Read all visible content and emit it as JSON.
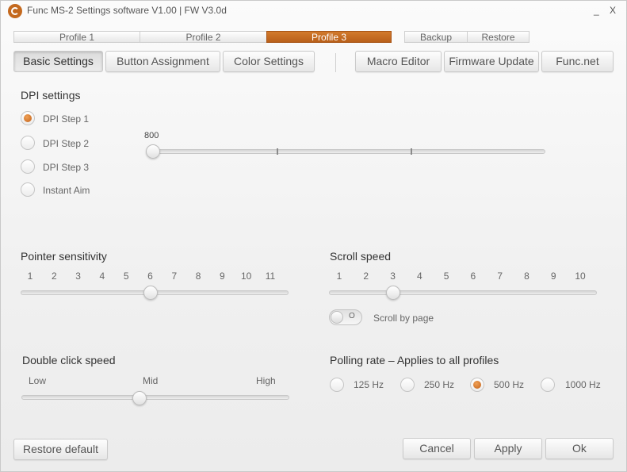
{
  "window": {
    "title": "Func MS-2 Settings software V1.00 | FW V3.0d",
    "minimize_label": "_",
    "close_label": "X"
  },
  "profiles": {
    "tabs": [
      "Profile 1",
      "Profile 2",
      "Profile 3"
    ],
    "active_index": 2
  },
  "utility": {
    "backup_label": "Backup",
    "restore_label": "Restore"
  },
  "nav": {
    "basic_settings": "Basic Settings",
    "button_assignment": "Button Assignment",
    "color_settings": "Color Settings",
    "macro_editor": "Macro Editor",
    "firmware_update": "Firmware Update",
    "func_net": "Func.net",
    "selected": "Basic Settings"
  },
  "dpi": {
    "heading": "DPI settings",
    "options": [
      "DPI Step 1",
      "DPI Step 2",
      "DPI Step 3",
      "Instant Aim"
    ],
    "selected_index": 0,
    "value_label": "800",
    "slider_fraction": 0.0
  },
  "pointer": {
    "heading": "Pointer sensitivity",
    "ticks": [
      "1",
      "2",
      "3",
      "4",
      "5",
      "6",
      "7",
      "8",
      "9",
      "10",
      "11"
    ],
    "value": 6
  },
  "scroll": {
    "heading": "Scroll speed",
    "ticks": [
      "1",
      "2",
      "3",
      "4",
      "5",
      "6",
      "7",
      "8",
      "9",
      "10"
    ],
    "value": 3,
    "toggle_state_label": "O",
    "scroll_by_page_label": "Scroll by page",
    "scroll_by_page": false
  },
  "double_click": {
    "heading": "Double click speed",
    "low": "Low",
    "mid": "Mid",
    "high": "High",
    "value_fraction": 0.44
  },
  "polling": {
    "heading": "Polling rate – Applies to all profiles",
    "options": [
      "125 Hz",
      "250 Hz",
      "500 Hz",
      "1000 Hz"
    ],
    "selected_index": 2
  },
  "footer": {
    "restore_default": "Restore default",
    "cancel": "Cancel",
    "apply": "Apply",
    "ok": "Ok"
  },
  "colors": {
    "accent": "#c4691e",
    "background": "#f2f2f2"
  }
}
